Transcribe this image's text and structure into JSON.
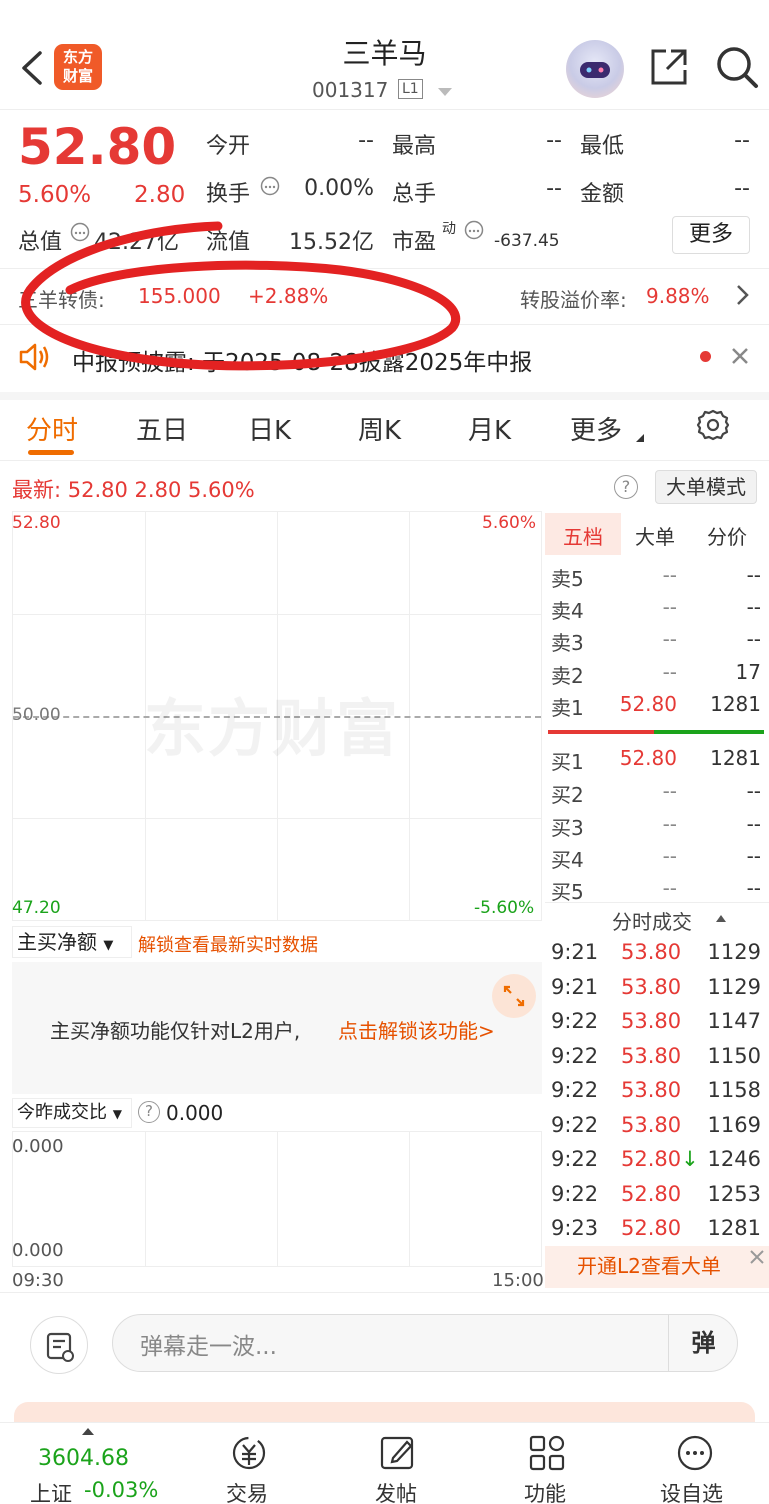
{
  "header": {
    "logo_text_1": "东方",
    "logo_text_2": "财富",
    "title": "三羊马",
    "code": "001317",
    "level_badge": "L1"
  },
  "quote": {
    "price": "52.80",
    "change_pct": "5.60%",
    "change": "2.80",
    "fields": {
      "open_label": "今开",
      "open_value": "--",
      "high_label": "最高",
      "high_value": "--",
      "low_label": "最低",
      "low_value": "--",
      "turnover_label": "换手",
      "turnover_value": "0.00%",
      "volume_label": "总手",
      "volume_value": "--",
      "amount_label": "金额",
      "amount_value": "--",
      "mktcap_label": "总值",
      "mktcap_value": "42.27亿",
      "float_label": "流值",
      "float_value": "15.52亿",
      "pe_label": "市盈",
      "pe_sup": "动",
      "pe_value": "-637.45"
    },
    "more_button": "更多"
  },
  "bond": {
    "label": "三羊转债:",
    "price": "155.000",
    "change": "+2.88%",
    "premium_label": "转股溢价率:",
    "premium_value": "9.88%"
  },
  "notice": {
    "text": "中报预披露: 于2025-08-28披露2025年中报"
  },
  "tabs": [
    "分时",
    "五日",
    "日K",
    "周K",
    "月K",
    "更多"
  ],
  "latest": {
    "text": "最新: 52.80  2.80  5.60%",
    "big_order_mode": "大单模式"
  },
  "chart_data": {
    "type": "line",
    "title": "",
    "y_price_top": "52.80",
    "y_price_mid": "50.00",
    "y_price_bottom": "47.20",
    "y_pct_top": "5.60%",
    "y_pct_bottom": "-5.60%",
    "x_start": "09:30",
    "x_end": "15:00",
    "watermark": "东方财富",
    "series": []
  },
  "orderbook": {
    "tabs": [
      "五档",
      "大单",
      "分价"
    ],
    "asks": [
      {
        "label": "卖5",
        "price": "--",
        "vol": "--"
      },
      {
        "label": "卖4",
        "price": "--",
        "vol": "--"
      },
      {
        "label": "卖3",
        "price": "--",
        "vol": "--"
      },
      {
        "label": "卖2",
        "price": "--",
        "vol": "17"
      },
      {
        "label": "卖1",
        "price": "52.80",
        "vol": "1281"
      }
    ],
    "bids": [
      {
        "label": "买1",
        "price": "52.80",
        "vol": "1281"
      },
      {
        "label": "买2",
        "price": "--",
        "vol": "--"
      },
      {
        "label": "买3",
        "price": "--",
        "vol": "--"
      },
      {
        "label": "买4",
        "price": "--",
        "vol": "--"
      },
      {
        "label": "买5",
        "price": "--",
        "vol": "--"
      }
    ]
  },
  "ticks": {
    "title": "分时成交",
    "rows": [
      {
        "time": "9:21",
        "price": "53.80",
        "vol": "1129"
      },
      {
        "time": "9:21",
        "price": "53.80",
        "vol": "1129"
      },
      {
        "time": "9:22",
        "price": "53.80",
        "vol": "1147"
      },
      {
        "time": "9:22",
        "price": "53.80",
        "vol": "1150"
      },
      {
        "time": "9:22",
        "price": "53.80",
        "vol": "1158"
      },
      {
        "time": "9:22",
        "price": "53.80",
        "vol": "1169"
      },
      {
        "time": "9:22",
        "price": "52.80↓",
        "vol": "1246"
      },
      {
        "time": "9:22",
        "price": "52.80",
        "vol": "1253"
      },
      {
        "time": "9:23",
        "price": "52.80",
        "vol": "1281"
      }
    ],
    "l2_banner": "开通L2查看大单"
  },
  "main_net": {
    "dropdown": "主买净额",
    "unlock_link": "解锁查看最新实时数据",
    "message": "主买净额功能仅针对L2用户,",
    "message_link": "点击解锁该功能>"
  },
  "ratio": {
    "dropdown": "今昨成交比",
    "value": "0.000",
    "y_top": "0.000",
    "y_bottom": "0.000"
  },
  "danmaku": {
    "placeholder": "弹幕走一波...",
    "button": "弹"
  },
  "bottom_bar": {
    "index_value": "3604.68",
    "index_name": "上证",
    "index_change": "-0.03%",
    "nav": [
      "交易",
      "发帖",
      "功能",
      "设自选"
    ]
  }
}
